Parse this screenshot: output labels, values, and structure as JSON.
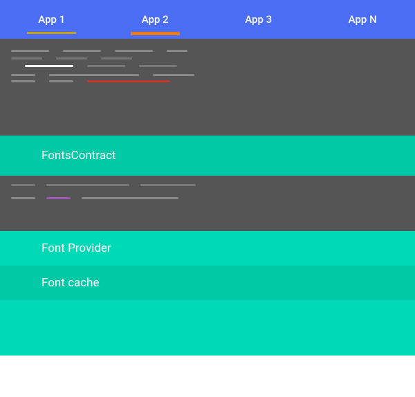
{
  "appBar": {
    "tabs": [
      {
        "id": "app1",
        "label": "App 1"
      },
      {
        "id": "app2",
        "label": "App 2"
      },
      {
        "id": "app3",
        "label": "App 3"
      },
      {
        "id": "appN",
        "label": "App N"
      }
    ]
  },
  "sections": {
    "fontsContract": {
      "label": "FontsContract"
    },
    "fontProvider": {
      "label": "Font Provider"
    },
    "fontCache": {
      "label": "Font cache"
    }
  },
  "colors": {
    "appBar": "#4B6EF5",
    "darkSection": "#555555",
    "greenLight": "#00C9A7",
    "greenMed": "#00D9B5",
    "tabUnderlineYellow": "#c8a000",
    "tabUnderlineOrange": "#e8781a"
  }
}
